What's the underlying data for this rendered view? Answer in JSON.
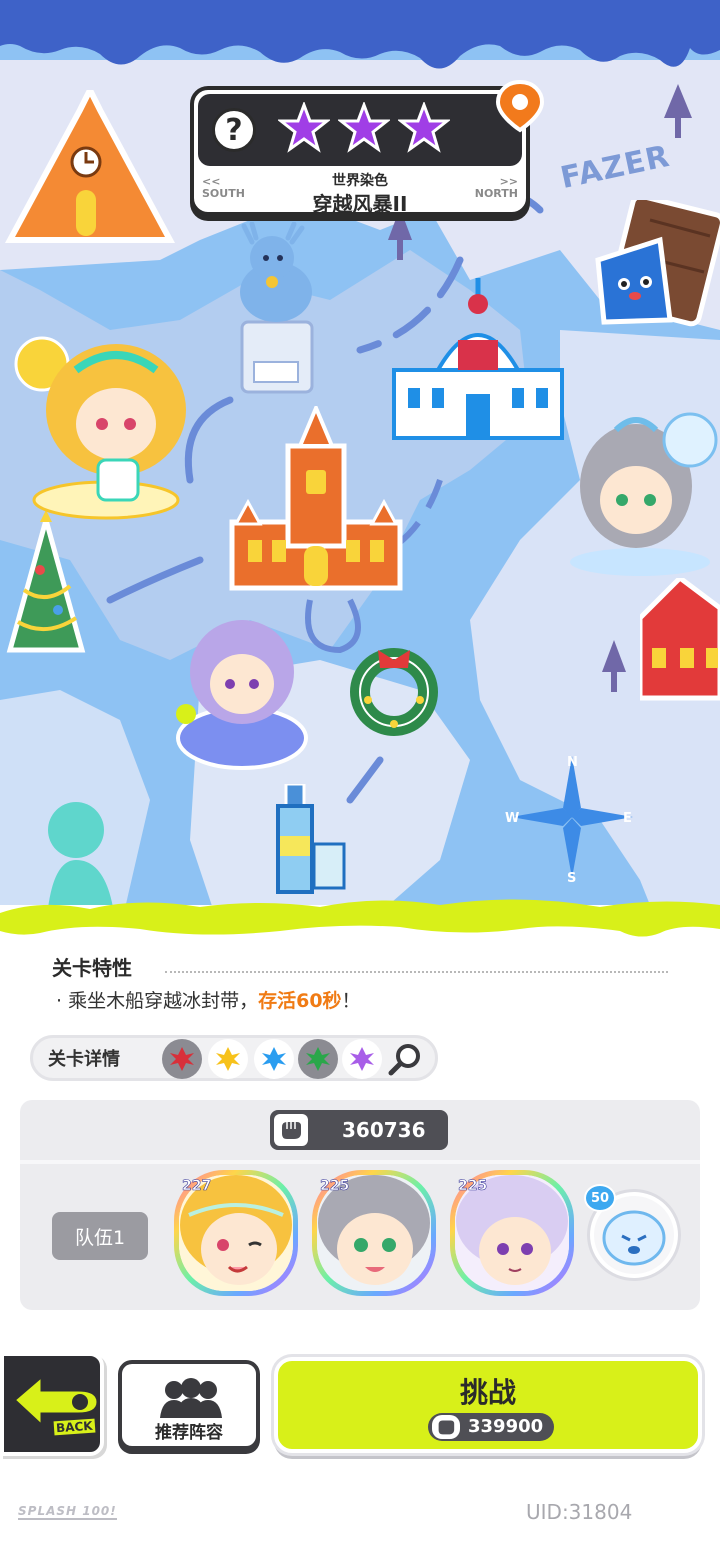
{
  "stage": {
    "stars": 3,
    "subtitle": "世界染色",
    "title": "穿越风暴II",
    "south_arrow": "<<",
    "south_label": "SOUTH",
    "north_arrow": ">>",
    "north_label": "NORTH"
  },
  "map": {
    "brand_sign": "FAZER",
    "compass": {
      "n": "N",
      "s": "S",
      "e": "E",
      "w": "W"
    }
  },
  "stage_features": {
    "title": "关卡特性",
    "text_prefix": "· 乘坐木船穿越冰封带，",
    "text_highlight": "存活60秒",
    "text_suffix": "！"
  },
  "stage_details": {
    "label": "关卡详情",
    "element_colors": [
      "#d8303a",
      "#f7c21b",
      "#2a9df0",
      "#2aa74a",
      "#a85ee8"
    ]
  },
  "team": {
    "power": "360736",
    "label": "队伍1",
    "members": [
      {
        "level": "227",
        "name": "blonde-character"
      },
      {
        "level": "225",
        "name": "silver-hair-character"
      },
      {
        "level": "225",
        "name": "purple-hair-character"
      }
    ],
    "pet_level": "50"
  },
  "buttons": {
    "back_label": "BACK",
    "recommend_label": "推荐阵容",
    "challenge_label": "挑战",
    "challenge_cost": "339900"
  },
  "footer": {
    "logo": "SPLASH 100!",
    "uid": "UID:31804"
  },
  "colors": {
    "accent_lime": "#d8f019",
    "star_purple": "#a03ee6",
    "highlight_orange": "#f07b14",
    "top_blue": "#3e62c8"
  }
}
